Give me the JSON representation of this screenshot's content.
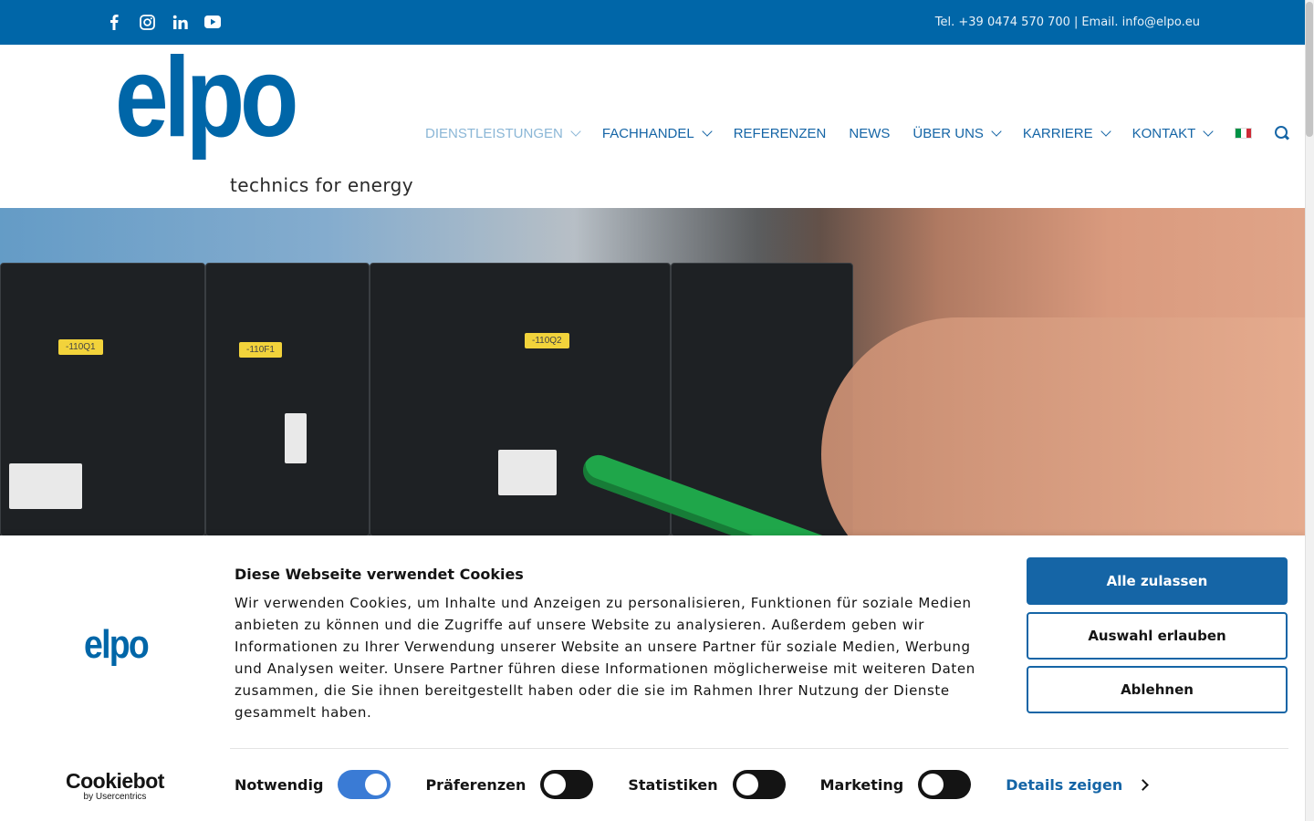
{
  "topbar": {
    "social": [
      "facebook-icon",
      "instagram-icon",
      "linkedin-icon",
      "youtube-icon"
    ],
    "phone": "Tel. +39 0474 570 700",
    "separator": "|",
    "email": "Email. info@elpo.eu",
    "background": "#0066a8"
  },
  "logo": {
    "word": "elpo",
    "tagline": "technics for energy",
    "color": "#0066a8"
  },
  "nav": {
    "items": [
      {
        "label": "DIENSTLEISTUNGEN",
        "dropdown": true,
        "active": true
      },
      {
        "label": "FACHHANDEL",
        "dropdown": true
      },
      {
        "label": "REFERENZEN",
        "dropdown": false
      },
      {
        "label": "NEWS",
        "dropdown": false
      },
      {
        "label": "ÜBER UNS",
        "dropdown": true
      },
      {
        "label": "KARRIERE",
        "dropdown": true
      },
      {
        "label": "KONTAKT",
        "dropdown": true
      }
    ],
    "language_icon": "italian-flag-icon",
    "search_icon": "search-icon"
  },
  "hero": {
    "labels": [
      "-110Q1",
      "-110F1",
      "-110Q2"
    ]
  },
  "cookie": {
    "logo_word": "elpo",
    "title": "Diese Webseite verwendet Cookies",
    "text": "Wir verwenden Cookies, um Inhalte und Anzeigen zu personalisieren, Funktionen für soziale Medien anbieten zu können und die Zugriffe auf unsere Website zu analysieren. Außerdem geben wir Informationen zu Ihrer Verwendung unserer Website an unsere Partner für soziale Medien, Werbung und Analysen weiter. Unsere Partner führen diese Informationen möglicherweise mit weiteren Daten zusammen, die Sie ihnen bereitgestellt haben oder die sie im Rahmen Ihrer Nutzung der Dienste gesammelt haben.",
    "buttons": {
      "allow_all": "Alle zulassen",
      "allow_selection": "Auswahl erlauben",
      "deny": "Ablehnen"
    },
    "toggles": [
      {
        "label": "Notwendig",
        "on": true
      },
      {
        "label": "Präferenzen",
        "on": false
      },
      {
        "label": "Statistiken",
        "on": false
      },
      {
        "label": "Marketing",
        "on": false
      }
    ],
    "details_label": "Details zeigen",
    "provider": "Cookiebot",
    "provider_sub": "by Usercentrics"
  }
}
